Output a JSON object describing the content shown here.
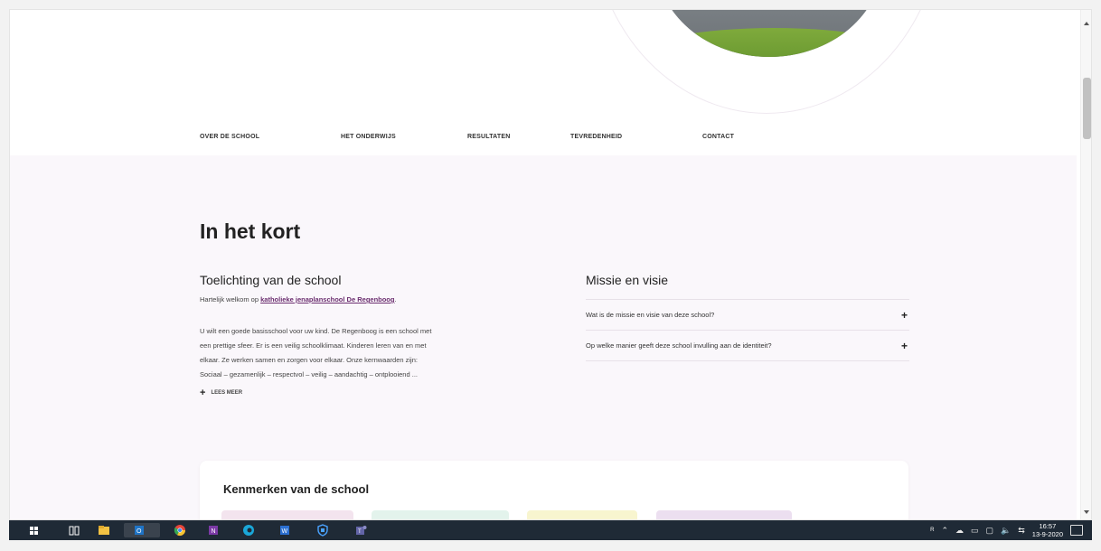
{
  "tabs": [
    {
      "label": "OVER DE SCHOOL",
      "active": true
    },
    {
      "label": "HET ONDERWIJS",
      "active": false
    },
    {
      "label": "RESULTATEN",
      "active": false
    },
    {
      "label": "TEVREDENHEID",
      "active": false
    },
    {
      "label": "CONTACT",
      "active": false
    }
  ],
  "section_title": "In het kort",
  "left": {
    "heading": "Toelichting van de school",
    "welcome_prefix": "Hartelijk welkom op ",
    "welcome_link": "katholieke jenaplanschool De Regenboog",
    "welcome_suffix": ".",
    "intro_lines": [
      "U wilt een goede basisschool voor uw kind. De Regenboog is een school met",
      "een prettige sfeer. Er is een veilig schoolklimaat. Kinderen leren van en met",
      "elkaar. Ze werken samen en zorgen voor elkaar. Onze kernwaarden zijn:",
      "Sociaal – gezamenlijk – respectvol – veilig – aandachtig – ontplooiend ..."
    ],
    "read_more": "LEES MEER"
  },
  "right": {
    "heading": "Missie en visie",
    "items": [
      "Wat is de missie en visie van deze school?",
      "Op welke manier geeft deze school invulling aan de identiteit?"
    ]
  },
  "card": {
    "title": "Kenmerken van de school"
  },
  "colors": {
    "accent": "#8a4d8f",
    "link": "#6b2e6f",
    "content_bg": "#faf7fb",
    "taskbar": "#1f2a36",
    "chips": [
      "#f3e4ee",
      "#e3f3ec",
      "#f8f5cf",
      "#ecdff0"
    ]
  },
  "taskbar": {
    "icons": [
      "windows-start-icon",
      "task-view-icon",
      "file-explorer-icon",
      "outlook-icon",
      "chrome-icon",
      "onenote-icon",
      "edge-icon",
      "word-icon",
      "defender-icon",
      "teams-icon"
    ],
    "clock_time": "16:57",
    "clock_date": "13-9-2020"
  }
}
